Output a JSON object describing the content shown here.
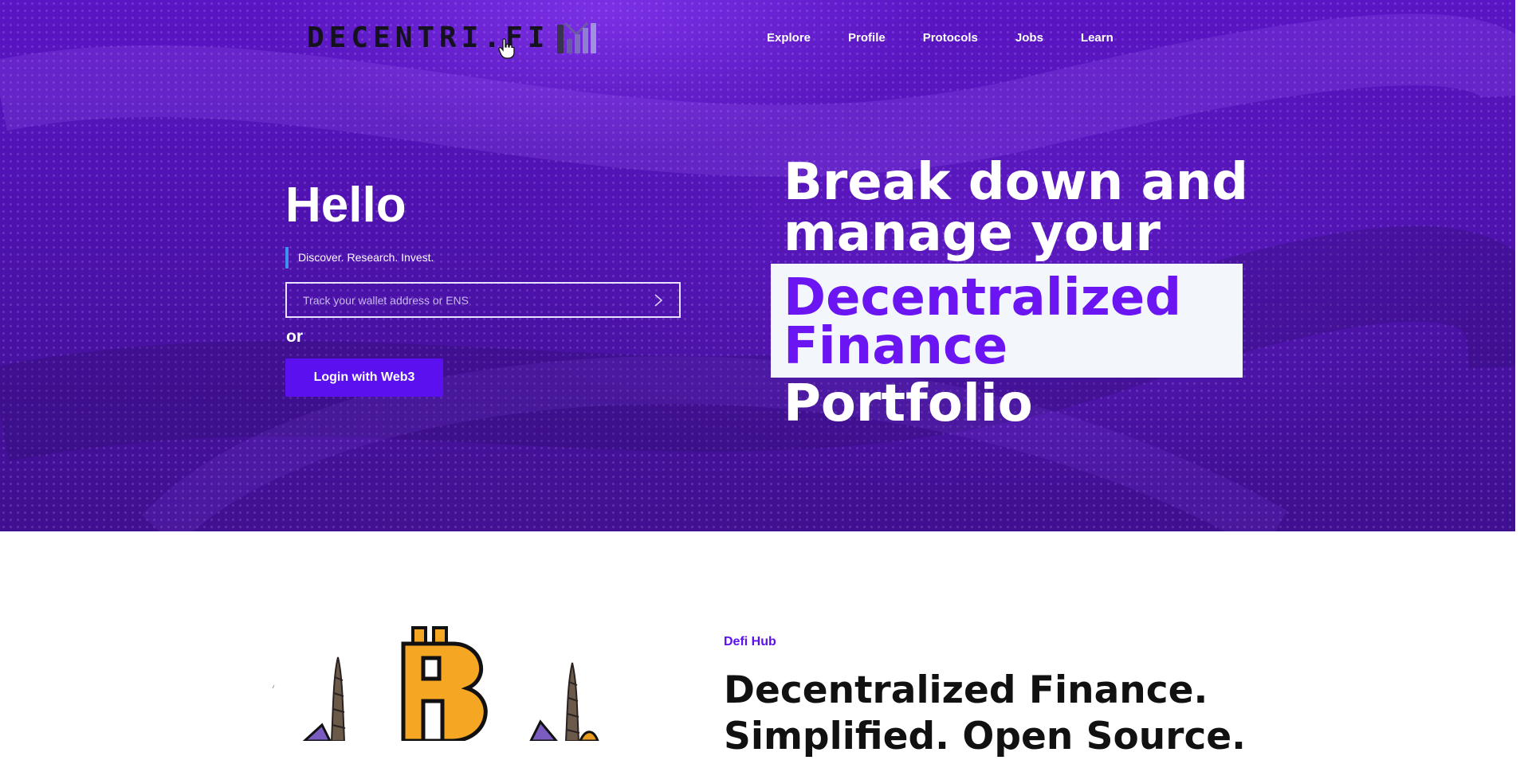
{
  "header": {
    "logo_text": "DECENTRI.FI",
    "nav": [
      "Explore",
      "Profile",
      "Protocols",
      "Jobs",
      "Learn"
    ]
  },
  "hero": {
    "greeting": "Hello",
    "tagline": "Discover. Research. Invest.",
    "search": {
      "placeholder": "Track your wallet address or ENS",
      "value": ""
    },
    "or_label": "or",
    "login_label": "Login with Web3",
    "headline": {
      "line1": "Break down and",
      "line2": "manage your",
      "highlight_line1": "Decentralized",
      "highlight_line2": "Finance",
      "line4": "Portfolio"
    }
  },
  "section": {
    "eyebrow": "Defi Hub",
    "title_line1": "Decentralized Finance.",
    "title_line2": "Simplified. Open Source."
  },
  "colors": {
    "accent": "#5b10f0",
    "hero_purple": "#4d12ad",
    "highlight_bg": "#f3f6fa",
    "tagline_bar": "#3d8ff0"
  },
  "icons": {
    "logo": "bar-chart-logo-icon",
    "search_submit": "chevron-right-icon",
    "cursor": "hand-pointer-icon",
    "illustration": "bitcoin-unicorn-illustration"
  }
}
